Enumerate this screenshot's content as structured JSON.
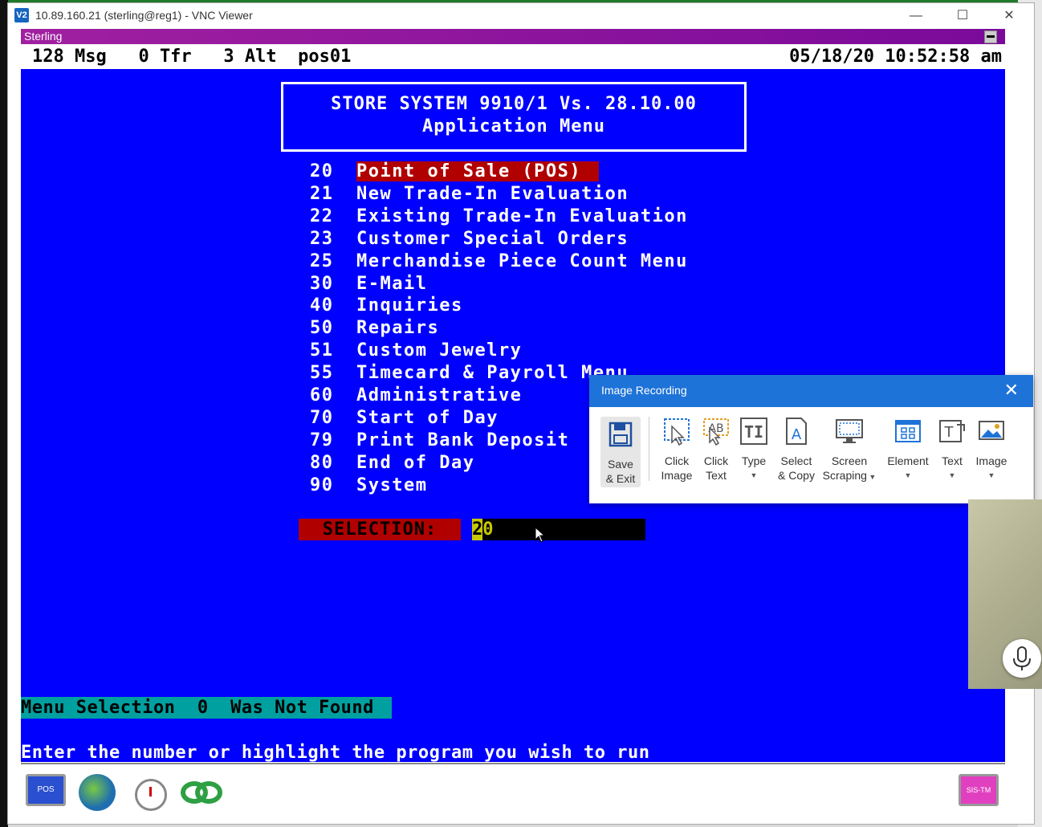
{
  "window": {
    "title": "10.89.160.21 (sterling@reg1) - VNC Viewer",
    "logo_text": "V2",
    "minimize_glyph": "—",
    "maximize_glyph": "☐",
    "close_glyph": "✕"
  },
  "app_bar": {
    "title": "Sterling",
    "control_glyph": "▬"
  },
  "status": {
    "left": "128 Msg   0 Tfr   3 Alt  pos01",
    "right": "05/18/20 10:52:58 am"
  },
  "header": {
    "line1": "STORE SYSTEM 9910/1  Vs. 28.10.00",
    "line2": "Application Menu"
  },
  "menu": [
    {
      "num": "20",
      "label": "Point of Sale (POS)"
    },
    {
      "num": "21",
      "label": "New Trade-In Evaluation"
    },
    {
      "num": "22",
      "label": "Existing Trade-In Evaluation"
    },
    {
      "num": "23",
      "label": "Customer Special Orders"
    },
    {
      "num": "25",
      "label": "Merchandise Piece Count Menu"
    },
    {
      "num": "30",
      "label": "E-Mail"
    },
    {
      "num": "40",
      "label": "Inquiries"
    },
    {
      "num": "50",
      "label": "Repairs"
    },
    {
      "num": "51",
      "label": "Custom Jewelry"
    },
    {
      "num": "55",
      "label": "Timecard & Payroll Menu"
    },
    {
      "num": "60",
      "label": "Administrative"
    },
    {
      "num": "70",
      "label": "Start of Day"
    },
    {
      "num": "79",
      "label": "Print Bank Deposit"
    },
    {
      "num": "80",
      "label": "End of Day"
    },
    {
      "num": "90",
      "label": "System"
    }
  ],
  "selection": {
    "label": "SELECTION:",
    "cursor_char": "2",
    "rest": "0"
  },
  "message": "Menu Selection  0  Was Not Found",
  "prompt": "Enter the number or highlight the program you wish to run",
  "taskbar": {
    "pos_label": "POS",
    "sys_label": "SIS-TM"
  },
  "recorder": {
    "title": "Image Recording",
    "close_glyph": "✕",
    "tools": [
      {
        "label": "Save\n& Exit"
      },
      {
        "label": "Click\nImage"
      },
      {
        "label": "Click\nText"
      },
      {
        "label": "Type"
      },
      {
        "label": "Select\n& Copy"
      },
      {
        "label": "Screen\nScraping"
      },
      {
        "label": "Element"
      },
      {
        "label": "Text"
      },
      {
        "label": "Image"
      }
    ],
    "click_text_glyph": "AB",
    "type_glyph": "TI",
    "select_glyph": "A",
    "text_glyph": "T"
  },
  "colors": {
    "terminal_bg": "#0000ff",
    "highlight": "#b00000",
    "message_bg": "#00a0a0",
    "recorder_accent": "#1e73d8"
  }
}
